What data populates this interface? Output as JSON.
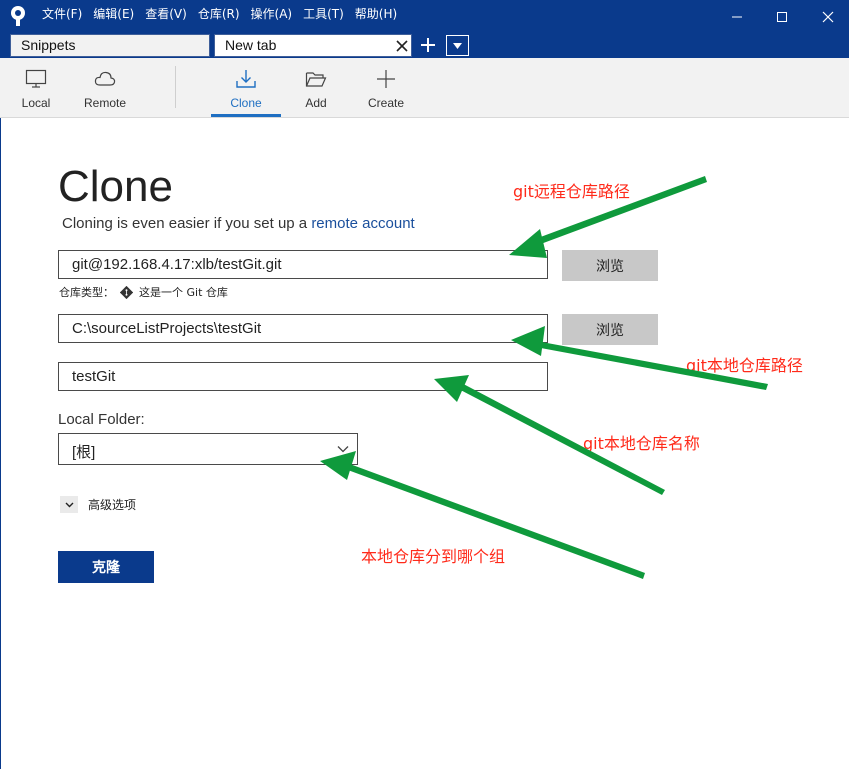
{
  "menu": [
    "文件(F)",
    "编辑(E)",
    "查看(V)",
    "仓库(R)",
    "操作(A)",
    "工具(T)",
    "帮助(H)"
  ],
  "tabs": [
    {
      "label": "Snippets"
    },
    {
      "label": "New tab"
    }
  ],
  "toolbar": {
    "local": "Local",
    "remote": "Remote",
    "clone": "Clone",
    "add": "Add",
    "create": "Create"
  },
  "clone_page": {
    "title": "Clone",
    "subtitle_prefix": "Cloning is even easier if you set up a ",
    "subtitle_link": "remote account",
    "source_url": "git@192.168.4.17:xlb/testGit.git",
    "browse_label": "浏览",
    "repo_type_label": "仓库类型：",
    "repo_type_value": "这是一个 Git 仓库",
    "destination_path": "C:\\sourceListProjects\\testGit",
    "name": "testGit",
    "local_folder_label": "Local Folder:",
    "local_folder_value": "[根]",
    "advanced_label": "高级选项",
    "clone_button": "克隆"
  },
  "annotations": {
    "remote_path": "git远程仓库路径",
    "local_path": "git本地仓库路径",
    "local_name": "git本地仓库名称",
    "group": "本地仓库分到哪个组"
  },
  "colors": {
    "titlebar": "#0a3a8c",
    "accent": "#1f6fc2",
    "annotation_text": "#ff2a1a",
    "annotation_arrow": "#0f9a3c"
  }
}
